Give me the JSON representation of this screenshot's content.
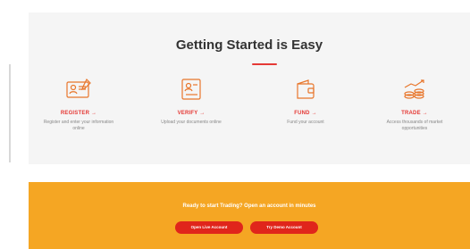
{
  "section": {
    "title": "Getting Started is Easy"
  },
  "steps": [
    {
      "label": "REGISTER →",
      "description": "Register and enter your information online",
      "icon": "id-card-icon"
    },
    {
      "label": "VERIFY →",
      "description": "Upload your documents online",
      "icon": "document-photo-icon"
    },
    {
      "label": "FUND →",
      "description": "Fund your account",
      "icon": "wallet-icon"
    },
    {
      "label": "TRADE →",
      "description": "Access thousands of market opportunities",
      "icon": "coins-chart-icon"
    }
  ],
  "banner": {
    "text": "Ready to start Trading? Open an account in minutes",
    "primary_button": "Open Live Account",
    "secondary_button": "Try Demo Account"
  },
  "colors": {
    "accent": "#e53935",
    "banner": "#f5a623",
    "button": "#e0251b"
  }
}
